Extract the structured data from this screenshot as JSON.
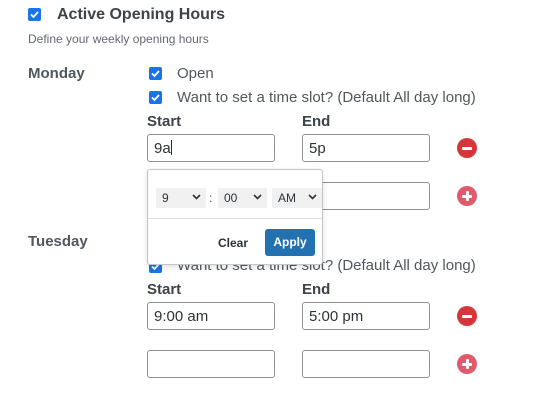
{
  "header": {
    "title": "Active Opening Hours",
    "subtitle": "Define your weekly opening hours",
    "enabled": true
  },
  "monday": {
    "day_label": "Monday",
    "open_label": "Open",
    "timeslot_label": "Want to set a time slot? (Default All day long)",
    "start_label": "Start",
    "end_label": "End",
    "slots": [
      {
        "start": "9a",
        "end": "5p"
      },
      {
        "start": "",
        "end": ""
      }
    ]
  },
  "time_picker": {
    "hour": "9",
    "minute": "00",
    "period": "AM",
    "separator": ":",
    "clear_label": "Clear",
    "apply_label": "Apply"
  },
  "tuesday": {
    "day_label": "Tuesday",
    "timeslot_label": "Want to set a time slot? (Default All day long)",
    "start_label": "Start",
    "end_label": "End",
    "slots": [
      {
        "start": "9:00 am",
        "end": "5:00 pm"
      },
      {
        "start": "",
        "end": ""
      }
    ]
  },
  "colors": {
    "checkbox": "#1a73e8",
    "remove_button": "#d63638",
    "add_button": "#e05a6d",
    "apply_button": "#2271b1"
  },
  "icons": {
    "check": "check-icon",
    "remove": "minus-circle-icon",
    "add": "plus-circle-icon",
    "chevron": "chevron-down-icon"
  }
}
